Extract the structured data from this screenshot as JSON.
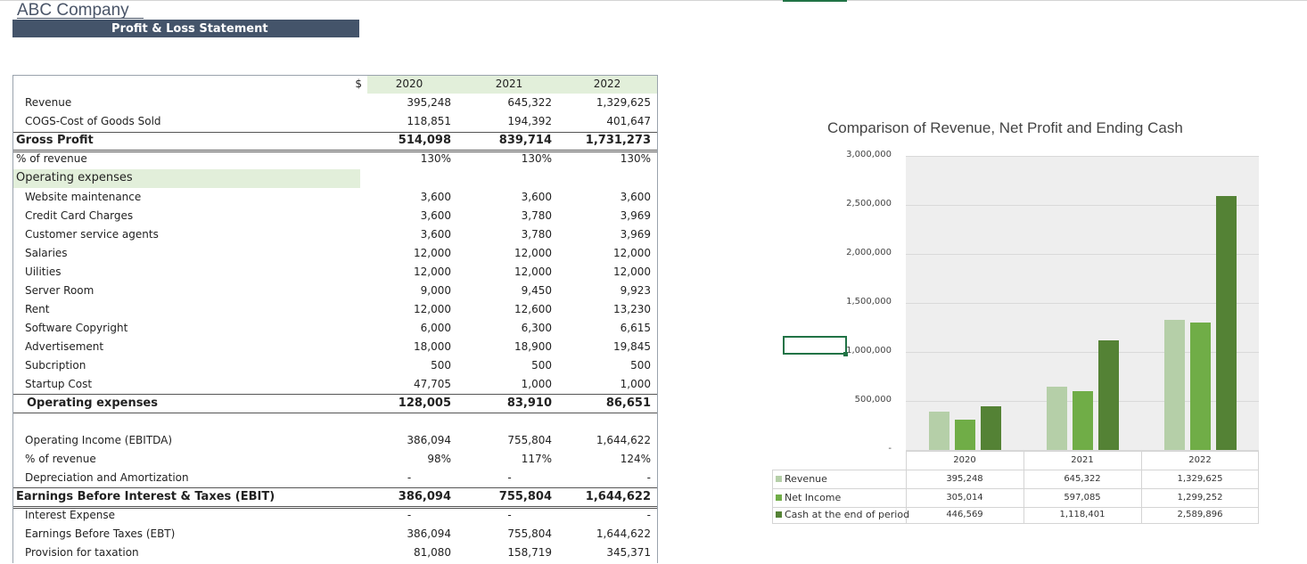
{
  "company": "ABC Company",
  "banner": "Profit & Loss Statement",
  "currency_symbol": "$",
  "years": [
    "2020",
    "2021",
    "2022"
  ],
  "pl_rows": {
    "revenue": {
      "label": "Revenue",
      "v": [
        "395,248",
        "645,322",
        "1,329,625"
      ]
    },
    "cogs": {
      "label": "COGS-Cost of Goods Sold",
      "v": [
        "118,851",
        "194,392",
        "401,647"
      ]
    },
    "gross_profit": {
      "label": "Gross Profit",
      "v": [
        "514,098",
        "839,714",
        "1,731,273"
      ]
    },
    "gp_pct": {
      "label": "% of revenue",
      "v": [
        "130%",
        "130%",
        "130%"
      ]
    },
    "opex_header": {
      "label": "Operating expenses"
    },
    "website": {
      "label": "Website maintenance",
      "v": [
        "3,600",
        "3,600",
        "3,600"
      ]
    },
    "credit_card": {
      "label": "Credit Card Charges",
      "v": [
        "3,600",
        "3,780",
        "3,969"
      ]
    },
    "customer_service": {
      "label": "Customer service agents",
      "v": [
        "3,600",
        "3,780",
        "3,969"
      ]
    },
    "salaries": {
      "label": "Salaries",
      "v": [
        "12,000",
        "12,000",
        "12,000"
      ]
    },
    "utilities": {
      "label": "Uilities",
      "v": [
        "12,000",
        "12,000",
        "12,000"
      ]
    },
    "server_room": {
      "label": "Server Room",
      "v": [
        "9,000",
        "9,450",
        "9,923"
      ]
    },
    "rent": {
      "label": "Rent",
      "v": [
        "12,000",
        "12,600",
        "13,230"
      ]
    },
    "software": {
      "label": "Software Copyright",
      "v": [
        "6,000",
        "6,300",
        "6,615"
      ]
    },
    "advertisement": {
      "label": "Advertisement",
      "v": [
        "18,000",
        "18,900",
        "19,845"
      ]
    },
    "subscription": {
      "label": "Subcription",
      "v": [
        "500",
        "500",
        "500"
      ]
    },
    "startup": {
      "label": "Startup Cost",
      "v": [
        "47,705",
        "1,000",
        "1,000"
      ]
    },
    "opex_total": {
      "label": "Operating expenses",
      "v": [
        "128,005",
        "83,910",
        "86,651"
      ]
    },
    "ebitda": {
      "label": "Operating Income (EBITDA)",
      "v": [
        "386,094",
        "755,804",
        "1,644,622"
      ]
    },
    "ebitda_pct": {
      "label": "% of revenue",
      "v": [
        "98%",
        "117%",
        "124%"
      ]
    },
    "depreciation": {
      "label": "Depreciation and Amortization",
      "v": [
        "-",
        "-",
        "-"
      ]
    },
    "ebit": {
      "label": "Earnings Before Interest & Taxes (EBIT)",
      "v": [
        "386,094",
        "755,804",
        "1,644,622"
      ]
    },
    "interest": {
      "label": "Interest Expense",
      "v": [
        "-",
        "-",
        "-"
      ]
    },
    "ebt": {
      "label": "Earnings Before Taxes (EBT)",
      "v": [
        "386,094",
        "755,804",
        "1,644,622"
      ]
    },
    "tax": {
      "label": "Provision for taxation",
      "v": [
        "81,080",
        "158,719",
        "345,371"
      ]
    }
  },
  "chart_data": {
    "type": "bar",
    "title": "Comparison of Revenue, Net Profit and Ending Cash",
    "categories": [
      "2020",
      "2021",
      "2022"
    ],
    "series": [
      {
        "name": "Revenue",
        "color": "#b5cfa8",
        "values": [
          395248,
          645322,
          1329625
        ],
        "labels": [
          "395,248",
          "645,322",
          "1,329,625"
        ]
      },
      {
        "name": "Net Income",
        "color": "#70ad47",
        "values": [
          305014,
          597085,
          1299252
        ],
        "labels": [
          "305,014",
          "597,085",
          "1,299,252"
        ]
      },
      {
        "name": "Cash at the end of period",
        "color": "#548235",
        "values": [
          446569,
          1118401,
          2589896
        ],
        "labels": [
          "446,569",
          "1,118,401",
          "2,589,896"
        ]
      }
    ],
    "ylim": [
      0,
      3000000
    ],
    "yticks": [
      "-",
      "500,000",
      "1,000,000",
      "1,500,000",
      "2,000,000",
      "2,500,000",
      "3,000,000"
    ],
    "ytick_values": [
      0,
      500000,
      1000000,
      1500000,
      2000000,
      2500000,
      3000000
    ],
    "legend": "data-table",
    "grid": true
  }
}
